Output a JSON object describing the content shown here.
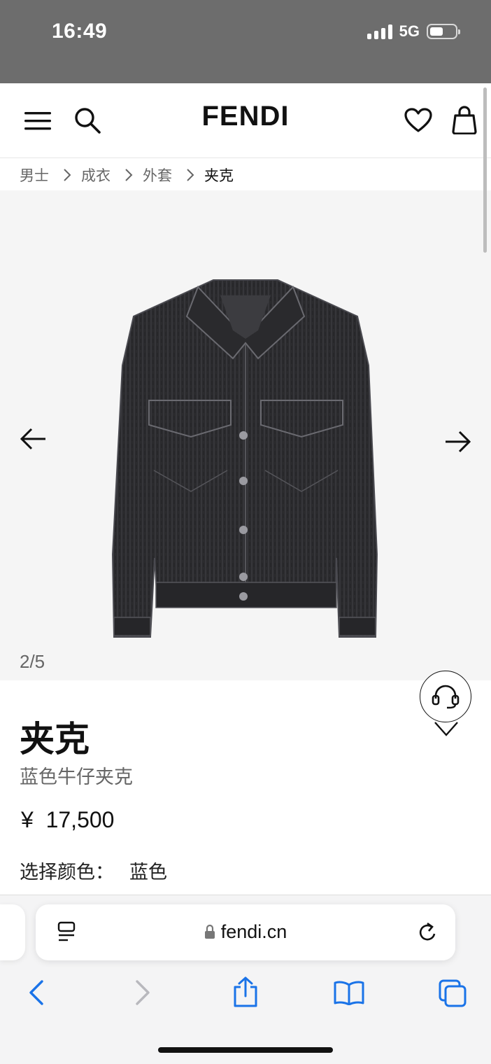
{
  "status": {
    "time": "16:49",
    "network": "5G",
    "battery_level": 0.45
  },
  "header": {
    "brand": "FENDI",
    "icons": [
      "menu-icon",
      "search-icon",
      "heart-icon",
      "bag-icon"
    ]
  },
  "breadcrumb": {
    "items": [
      "男士",
      "成衣",
      "外套",
      "夹克"
    ]
  },
  "gallery": {
    "counter": "2/5"
  },
  "product": {
    "title": "夹克",
    "subtitle": "蓝色牛仔夹克",
    "currency": "¥",
    "price": "17,500",
    "color_label": "选择颜色：",
    "color_value": "蓝色"
  },
  "browser": {
    "url": "fendi.cn",
    "icons": [
      "reader-icon",
      "lock-icon",
      "reload-icon",
      "back-icon",
      "forward-icon",
      "share-icon",
      "bookmarks-icon",
      "tabs-icon"
    ],
    "accent": "#1a73e8"
  }
}
